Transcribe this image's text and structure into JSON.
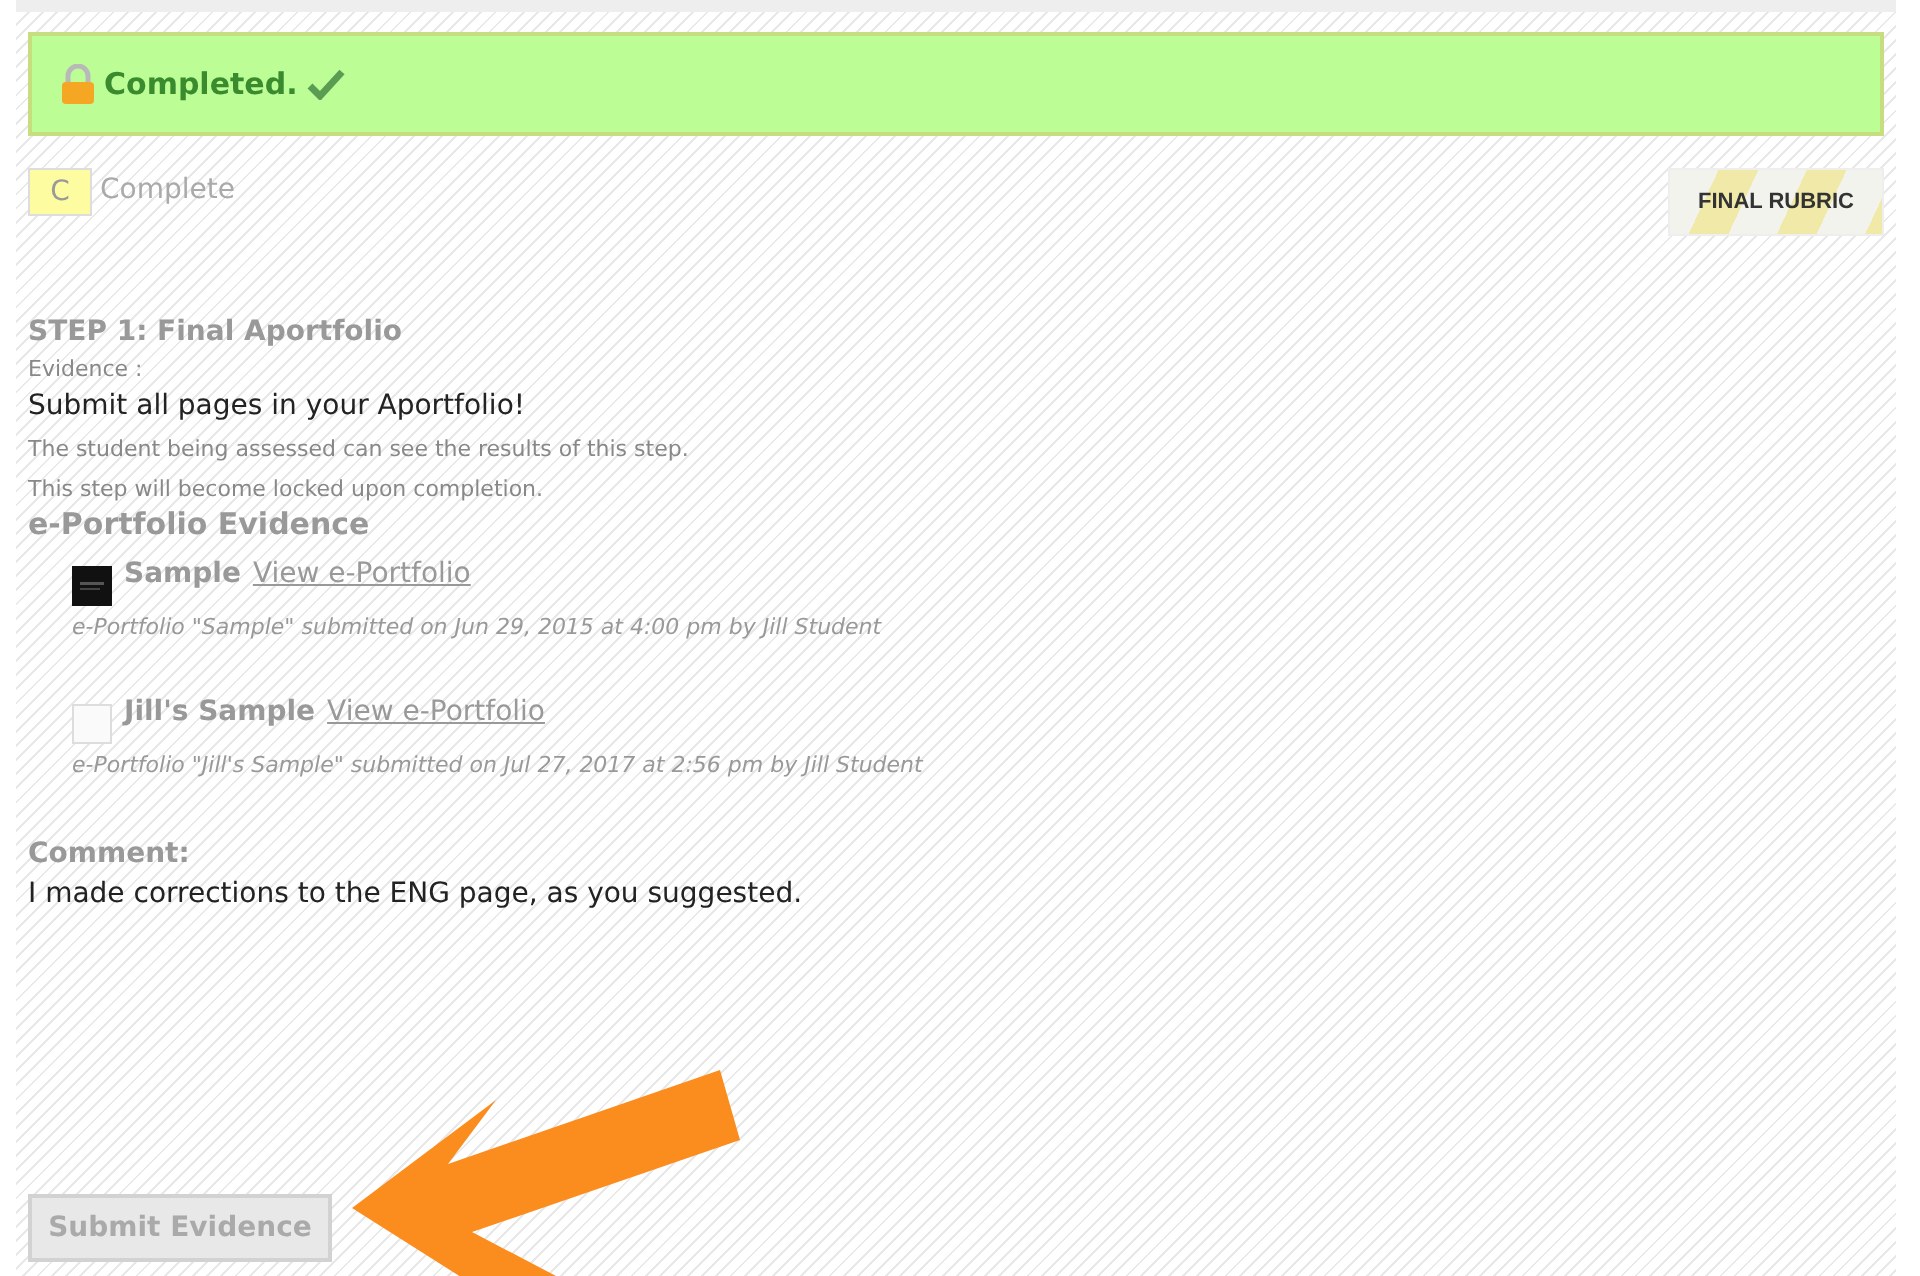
{
  "status_banner": {
    "text": "Completed.",
    "locked": true,
    "done": true
  },
  "grade": {
    "letter": "C",
    "label": "Complete"
  },
  "rubric_button": {
    "label": "FINAL RUBRIC"
  },
  "step": {
    "title": "STEP 1: Final Aportfolio",
    "evidence_label": "Evidence :",
    "instruction": "Submit all pages in your Aportfolio!",
    "notes": [
      "The student being assessed can see the results of this step.",
      "This step will become locked upon completion."
    ]
  },
  "evidence": {
    "heading": "e-Portfolio Evidence",
    "items": [
      {
        "kind": "dark",
        "name": "Sample",
        "link": "View e-Portfolio",
        "meta": "e-Portfolio \"Sample\" submitted on Jun 29, 2015 at 4:00 pm by Jill Student"
      },
      {
        "kind": "blank",
        "name": "Jill's Sample",
        "link": "View e-Portfolio",
        "meta": "e-Portfolio \"Jill's Sample\" submitted on Jul 27, 2017 at 2:56 pm by Jill Student"
      }
    ]
  },
  "comment": {
    "label": "Comment:",
    "text": "I made corrections to the ENG page, as you suggested."
  },
  "submit_button": {
    "label": "Submit Evidence",
    "disabled": true
  }
}
